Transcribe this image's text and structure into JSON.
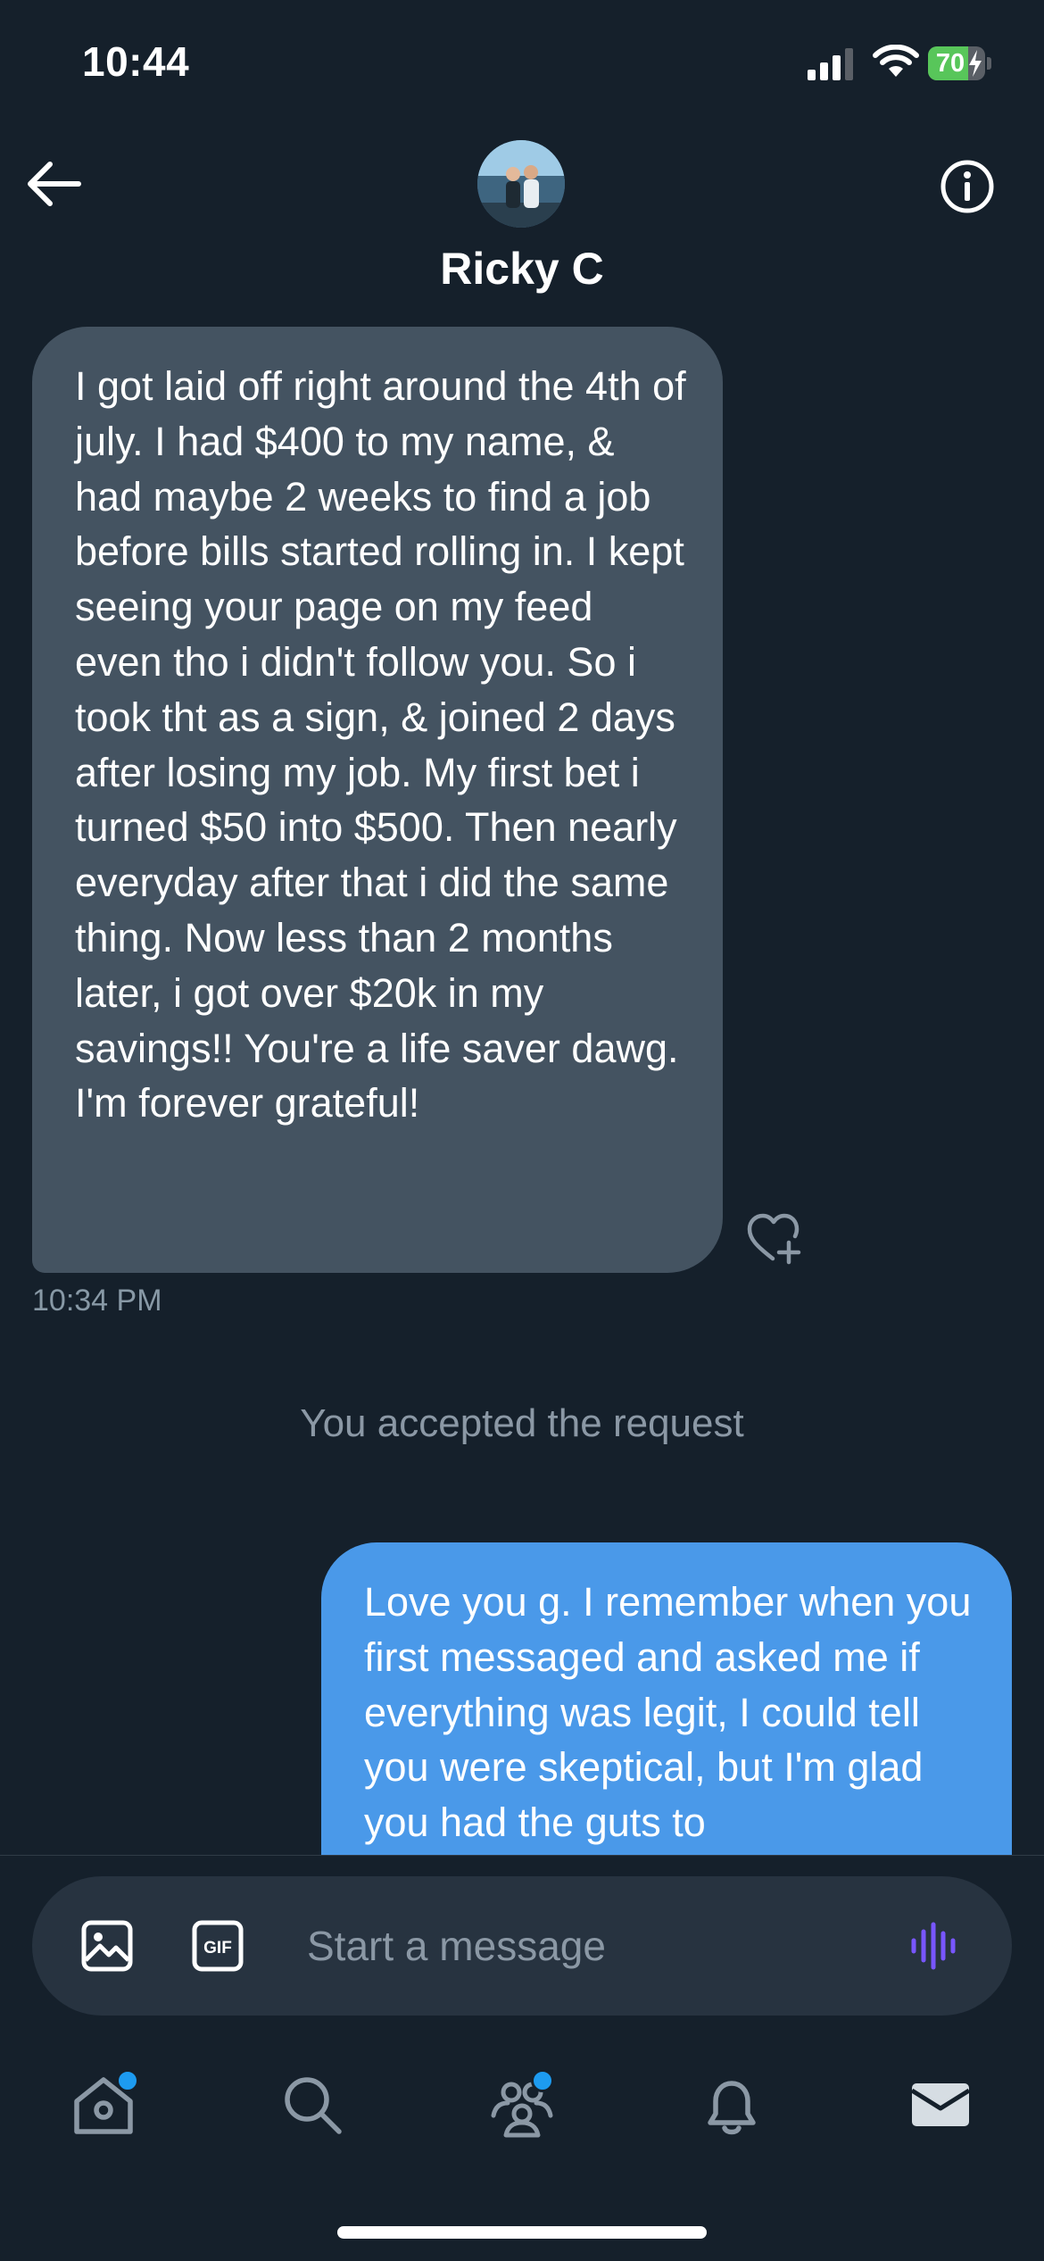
{
  "status_bar": {
    "time": "10:44",
    "battery_percent": "70",
    "battery_level": 0.7,
    "battery_color": "#58c65a"
  },
  "header": {
    "contact_name": "Ricky C",
    "back_icon": "arrow-left-icon",
    "info_icon": "info-circle-icon"
  },
  "messages": [
    {
      "direction": "received",
      "text": "I got laid off right around the 4th of july. I had $400 to my name, & had maybe 2 weeks to find a job before bills started rolling in. I kept seeing your page on my feed even tho i didn't follow you. So i took tht as a sign, & joined 2 days after losing my job. My first bet i turned $50 into $500. Then nearly everyday after that i did the same thing. Now less than 2 months later, i got over $20k in my savings!! You're a life saver dawg. I'm forever grateful!",
      "time": "10:34 PM",
      "bubble_color": "#445361"
    },
    {
      "direction": "sent",
      "text": "Love you g. I remember when you first messaged and asked me if everything was legit, I could tell you were skeptical, but I'm glad you had the guts to",
      "bubble_color": "#4a99e9"
    }
  ],
  "system_notice": "You accepted the request",
  "composer": {
    "placeholder": "Start a message",
    "gif_label": "GIF",
    "image_icon": "image-icon",
    "voice_icon": "voice-waveform-icon",
    "voice_color": "#7856ff"
  },
  "nav": {
    "items": [
      {
        "name": "home",
        "icon": "home-icon",
        "has_dot": true
      },
      {
        "name": "search",
        "icon": "search-icon",
        "has_dot": false
      },
      {
        "name": "communities",
        "icon": "communities-icon",
        "has_dot": true
      },
      {
        "name": "notifications",
        "icon": "bell-icon",
        "has_dot": false
      },
      {
        "name": "messages",
        "icon": "envelope-icon",
        "has_dot": false,
        "active": true
      }
    ],
    "dot_color": "#1d9bf0"
  }
}
